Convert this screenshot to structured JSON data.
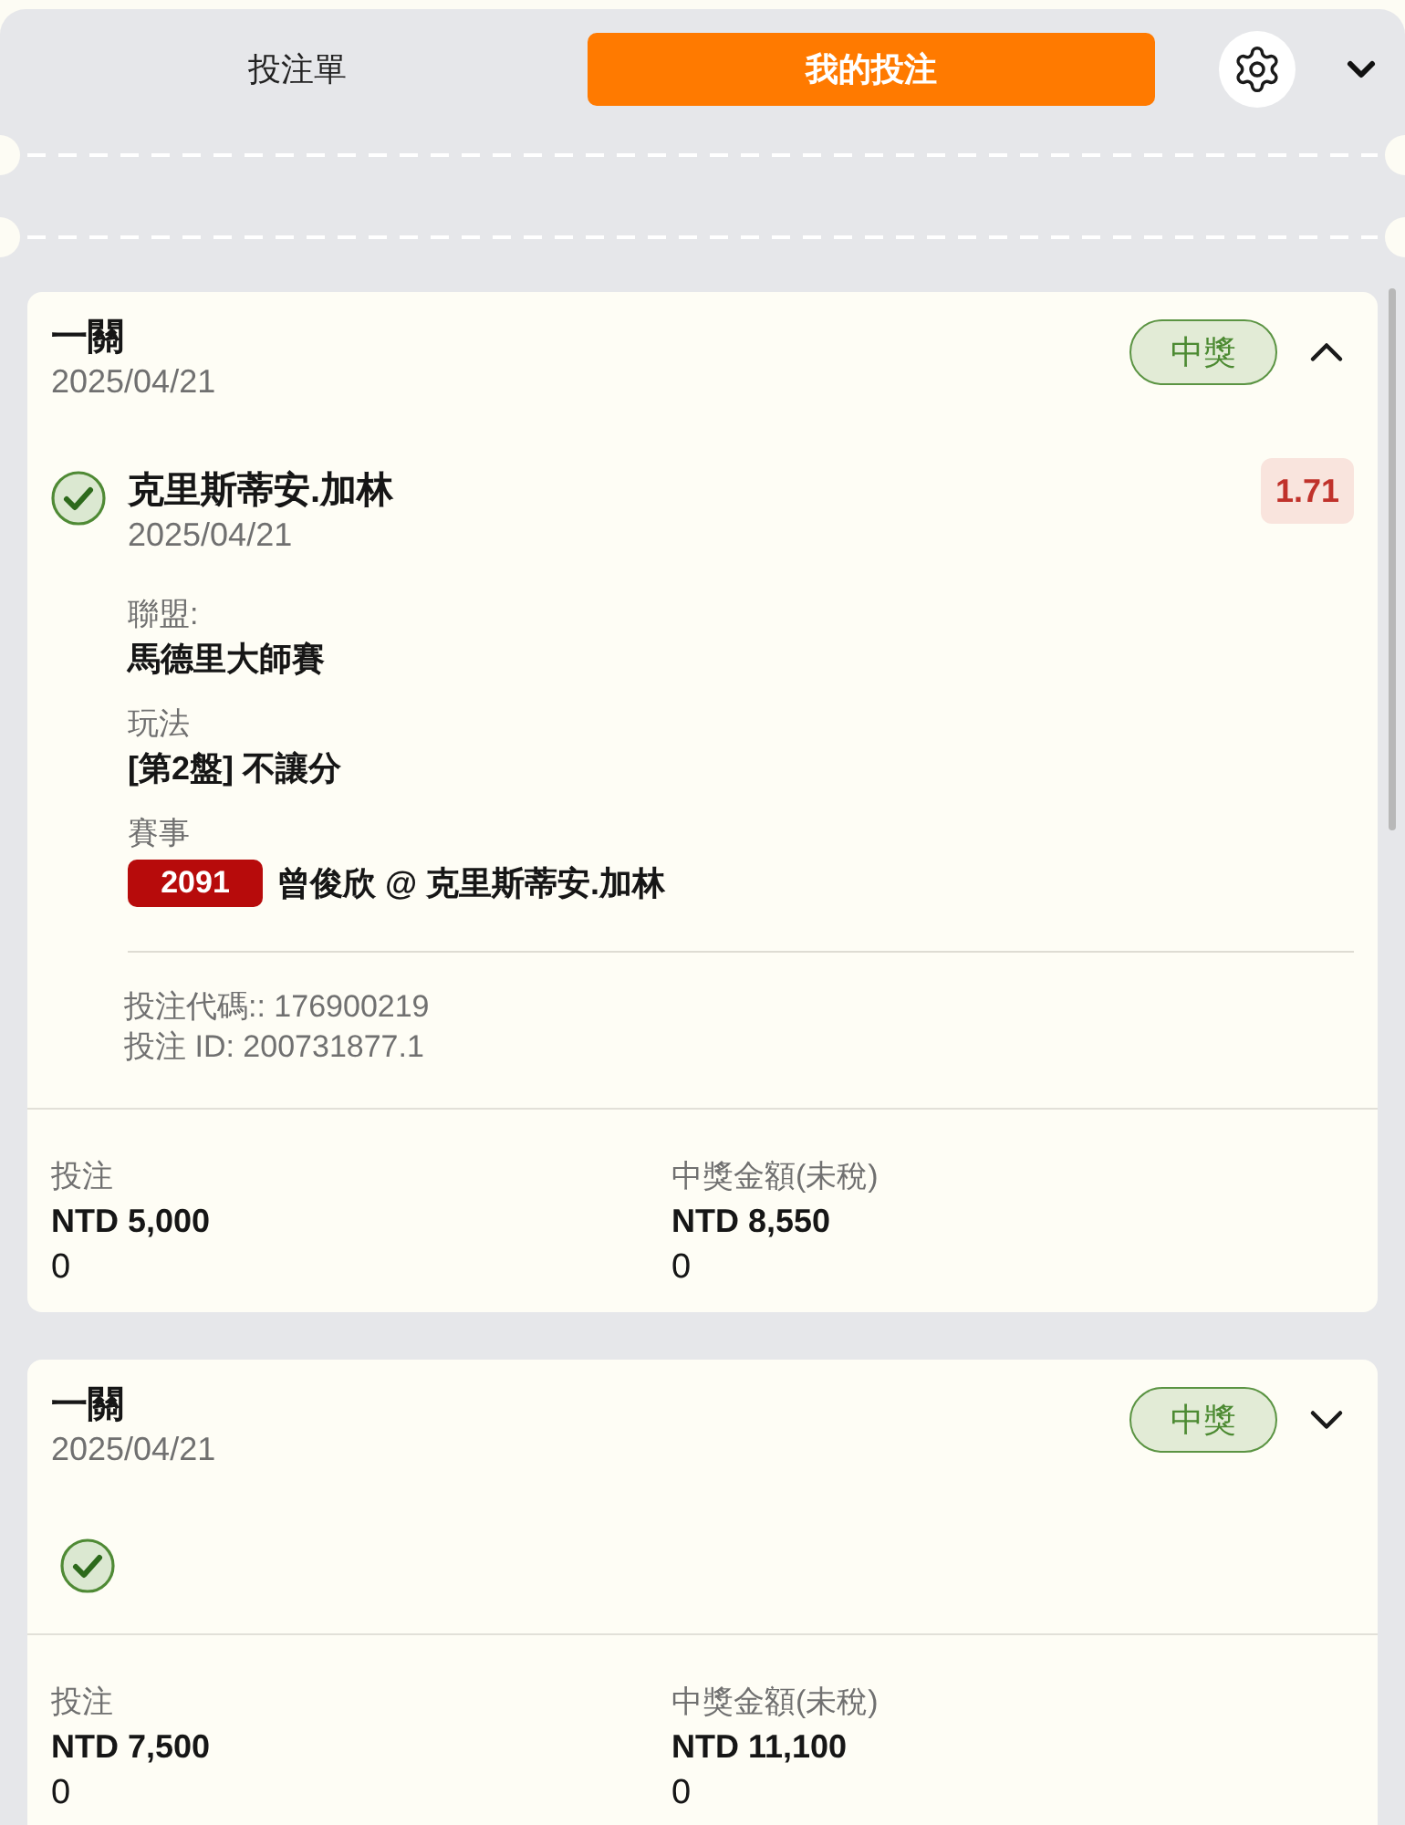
{
  "header": {
    "tabs": [
      {
        "label": "投注單",
        "selected": false
      },
      {
        "label": "我的投注",
        "selected": true
      }
    ]
  },
  "bets": [
    {
      "type": "一關",
      "date": "2025/04/21",
      "status": "中獎",
      "expanded": true,
      "legs": [
        {
          "won": true,
          "selection": "克里斯蒂安.加林",
          "date": "2025/04/21",
          "odds": "1.71",
          "details": [
            {
              "kind": "text",
              "label": "聯盟:",
              "value": "馬德里大師賽"
            },
            {
              "kind": "text",
              "label": "玩法",
              "value": "[第2盤] 不讓分"
            },
            {
              "kind": "event",
              "label": "賽事",
              "event_code": "2091",
              "value": "曾俊欣 @ 克里斯蒂安.加林"
            }
          ]
        }
      ],
      "bet_code": "投注代碼:: 176900219",
      "bet_id": "投注 ID: 200731877.1",
      "summary": [
        {
          "label": "投注",
          "amount": "NTD 5,000",
          "value": "0"
        },
        {
          "label": "中獎金額(未稅)",
          "amount": "NTD 8,550",
          "value": "0"
        }
      ]
    },
    {
      "type": "一關",
      "date": "2025/04/21",
      "status": "中獎",
      "expanded": false,
      "legs": [
        {
          "won": true
        }
      ],
      "summary": [
        {
          "label": "投注",
          "amount": "NTD 7,500",
          "value": "0"
        },
        {
          "label": "中獎金額(未稅)",
          "amount": "NTD 11,100",
          "value": "0"
        }
      ]
    }
  ]
}
